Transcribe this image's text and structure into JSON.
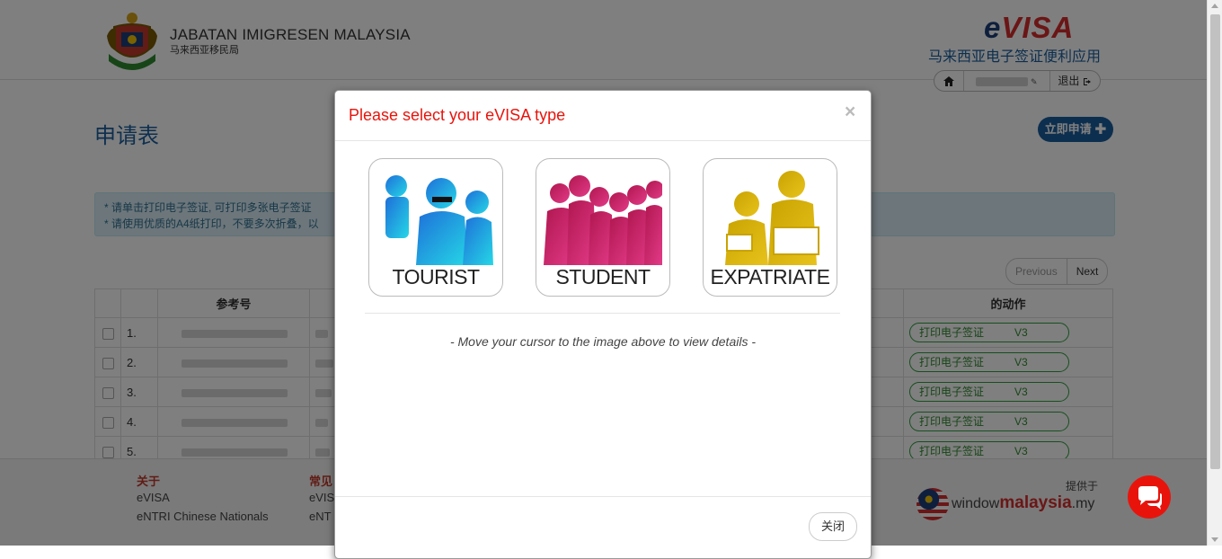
{
  "header": {
    "org_name": "JABATAN IMIGRESEN MALAYSIA",
    "org_subtitle": "马来西亚移民局",
    "brand_e": "e",
    "brand_visa": "VISA",
    "brand_subtitle": "马来西亚电子签证便利应用",
    "logout_label": "退出"
  },
  "main": {
    "page_title": "申请表",
    "apply_button": "立即申请",
    "notices": [
      "* 请单击打印电子签证, 可打印多张电子签证",
      "* 请使用优质的A4纸打印，不要多次折叠，以"
    ],
    "pagination": {
      "previous": "Previous",
      "next": "Next"
    },
    "table": {
      "columns": [
        "",
        "",
        "参考号",
        "",
        "",
        "的动作"
      ],
      "rows": [
        {
          "no": "1.",
          "action": "打印电子签证",
          "version": "V3"
        },
        {
          "no": "2.",
          "action": "打印电子签证",
          "version": "V3"
        },
        {
          "no": "3.",
          "action": "打印电子签证",
          "version": "V3"
        },
        {
          "no": "4.",
          "action": "打印电子签证",
          "version": "V3"
        },
        {
          "no": "5.",
          "action": "打印电子签证",
          "version": "V3"
        }
      ]
    }
  },
  "footer": {
    "about_title": "关于",
    "about_links": [
      "eVISA",
      "eNTRI Chinese Nationals"
    ],
    "faq_title": "常见",
    "faq_links": [
      "eVIS",
      "eNT"
    ],
    "provided_by": "提供于",
    "partner_name_prefix": "window",
    "partner_name_bold": "malaysia",
    "partner_name_suffix": ".my"
  },
  "modal": {
    "title": "Please select your eVISA type",
    "close_x": "×",
    "options": [
      {
        "label": "TOURIST",
        "color_from": "#1e6fd9",
        "color_to": "#25d7e6"
      },
      {
        "label": "STUDENT",
        "color_from": "#b0174f",
        "color_to": "#e23a88"
      },
      {
        "label": "EXPATRIATE",
        "color_from": "#c9a300",
        "color_to": "#e8c21c"
      }
    ],
    "hint": "- Move your cursor to the image above to view details -",
    "close_button": "关闭"
  },
  "colors": {
    "brand_blue": "#1b5e9e",
    "modal_title_red": "#e8140c",
    "action_green": "#2e8a2e",
    "chat_red": "#e8140c"
  }
}
